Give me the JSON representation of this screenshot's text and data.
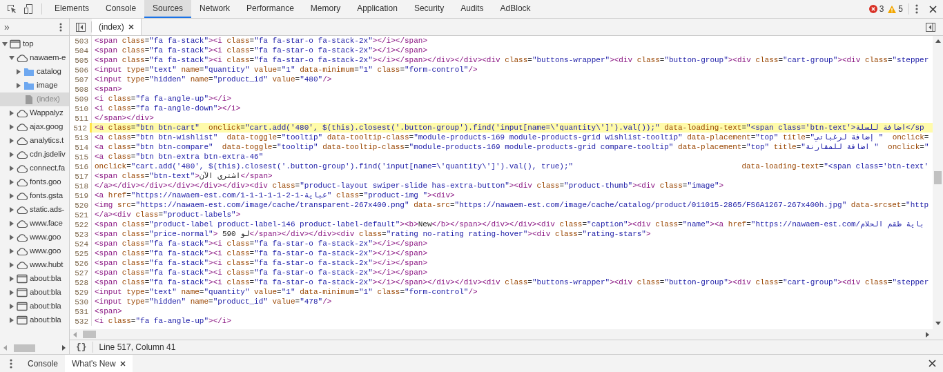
{
  "toolbar": {
    "tabs": [
      {
        "label": "Elements",
        "selected": false
      },
      {
        "label": "Console",
        "selected": false
      },
      {
        "label": "Sources",
        "selected": true
      },
      {
        "label": "Network",
        "selected": false
      },
      {
        "label": "Performance",
        "selected": false
      },
      {
        "label": "Memory",
        "selected": false
      },
      {
        "label": "Application",
        "selected": false
      },
      {
        "label": "Security",
        "selected": false
      },
      {
        "label": "Audits",
        "selected": false
      },
      {
        "label": "AdBlock",
        "selected": false
      }
    ],
    "errors": "3",
    "warnings": "5"
  },
  "editor_tabs": [
    {
      "label": "(index)",
      "selected": true
    }
  ],
  "navigator": {
    "more_tabs": "»",
    "tree": [
      {
        "label": "top",
        "kind": "frame",
        "expanded": true,
        "selected": false,
        "children": [
          {
            "label": "nawaem-e",
            "kind": "cloud",
            "expanded": true,
            "selected": false,
            "children": [
              {
                "label": "catalog",
                "kind": "folder",
                "expanded": false,
                "selected": false
              },
              {
                "label": "image",
                "kind": "folder",
                "expanded": false,
                "selected": false
              },
              {
                "label": "(index)",
                "kind": "file",
                "selected": true
              }
            ]
          },
          {
            "label": "Wappalyz",
            "kind": "cloud",
            "expanded": false,
            "selected": false
          },
          {
            "label": "ajax.goog",
            "kind": "cloud",
            "expanded": false,
            "selected": false
          },
          {
            "label": "analytics.t",
            "kind": "cloud",
            "expanded": false,
            "selected": false
          },
          {
            "label": "cdn.jsdeliv",
            "kind": "cloud",
            "expanded": false,
            "selected": false
          },
          {
            "label": "connect.fa",
            "kind": "cloud",
            "expanded": false,
            "selected": false
          },
          {
            "label": "fonts.goo",
            "kind": "cloud",
            "expanded": false,
            "selected": false
          },
          {
            "label": "fonts.gsta",
            "kind": "cloud",
            "expanded": false,
            "selected": false
          },
          {
            "label": "static.ads-",
            "kind": "cloud",
            "expanded": false,
            "selected": false
          },
          {
            "label": "www.face",
            "kind": "cloud",
            "expanded": false,
            "selected": false
          },
          {
            "label": "www.goo",
            "kind": "cloud",
            "expanded": false,
            "selected": false
          },
          {
            "label": "www.goo",
            "kind": "cloud",
            "expanded": false,
            "selected": false
          },
          {
            "label": "www.hubt",
            "kind": "cloud",
            "expanded": false,
            "selected": false
          },
          {
            "label": "about:bla",
            "kind": "frame",
            "expanded": false,
            "selected": false
          },
          {
            "label": "about:bla",
            "kind": "frame",
            "expanded": false,
            "selected": false
          },
          {
            "label": "about:bla",
            "kind": "frame",
            "expanded": false,
            "selected": false
          },
          {
            "label": "about:bla",
            "kind": "frame",
            "expanded": false,
            "selected": false
          }
        ]
      }
    ]
  },
  "code_lines": [
    {
      "number": "503",
      "text": "<span class=\"fa fa-stack\"><i class=\"fa fa-star-o fa-stack-2x\"></i></span>",
      "highlighted": false
    },
    {
      "number": "504",
      "text": "<span class=\"fa fa-stack\"><i class=\"fa fa-star-o fa-stack-2x\"></i></span>",
      "highlighted": false
    },
    {
      "number": "505",
      "text": "<span class=\"fa fa-stack\"><i class=\"fa fa-star-o fa-stack-2x\"></i></span></div></div><div class=\"buttons-wrapper\"><div class=\"button-group\"><div class=\"cart-group\"><div class=\"stepper",
      "highlighted": false
    },
    {
      "number": "506",
      "text": "<input type=\"text\" name=\"quantity\" value=\"1\" data-minimum=\"1\" class=\"form-control\"/>",
      "highlighted": false
    },
    {
      "number": "507",
      "text": "<input type=\"hidden\" name=\"product_id\" value=\"480\"/>",
      "highlighted": false
    },
    {
      "number": "508",
      "text": "<span>",
      "highlighted": false
    },
    {
      "number": "509",
      "text": "<i class=\"fa fa-angle-up\"></i>",
      "highlighted": false
    },
    {
      "number": "510",
      "text": "<i class=\"fa fa-angle-down\"></i>",
      "highlighted": false
    },
    {
      "number": "511",
      "text": "</span></div>",
      "highlighted": false
    },
    {
      "number": "512",
      "text": "<a class=\"btn btn-cart\"  onclick=\"cart.add('480', $(this).closest('.button-group').find('input[name=\\'quantity\\']').val());\" data-loading-text=\"<span class='btn-text'>اضافة للسلة</sp",
      "highlighted": true
    },
    {
      "number": "513",
      "text": "<a class=\"btn btn-wishlist\"  data-toggle=\"tooltip\" data-tooltip-class=\"module-products-169 module-products-grid wishlist-tooltip\" data-placement=\"top\" title=\"إضافة لرغباتي \"  onclick=",
      "highlighted": false
    },
    {
      "number": "514",
      "text": "<a class=\"btn btn-compare\"  data-toggle=\"tooltip\" data-tooltip-class=\"module-products-169 module-products-grid compare-tooltip\" data-placement=\"top\" title=\"اضافة للمقارنة \"  onclick=\"",
      "highlighted": false
    },
    {
      "number": "515",
      "text": "<a class=\"btn btn-extra btn-extra-46\"",
      "highlighted": false
    },
    {
      "number": "516",
      "text": "onclick=\"cart.add('480', $(this).closest('.button-group').find('input[name=\\'quantity\\']').val(), true);\"                                     data-loading-text=\"<span class='btn-text'",
      "highlighted": false
    },
    {
      "number": "517",
      "text": "<span class=\"btn-text\">اشتري الآن</span>",
      "highlighted": false
    },
    {
      "number": "518",
      "text": "</a></div></div></div></div></div><div class=\"product-layout swiper-slide has-extra-button\"><div class=\"product-thumb\"><div class=\"image\">",
      "highlighted": false
    },
    {
      "number": "519",
      "text": "<a href=\"https://nawaem-est.com/1-1-1-1-1-2-1-عباية\" class=\"product-img \"><div>",
      "highlighted": false
    },
    {
      "number": "520",
      "text": "<img src=\"https://nawaem-est.com/image/cache/transparent-267x400.png\" data-src=\"https://nawaem-est.com/image/cache/catalog/product/011015-2865/FS6A1267-267x400h.jpg\" data-srcset=\"http",
      "highlighted": false
    },
    {
      "number": "521",
      "text": "</a><div class=\"product-labels\">",
      "highlighted": false
    },
    {
      "number": "522",
      "text": "<span class=\"product-label product-label-146 product-label-default\"><b>New</b></span></div></div><div class=\"caption\"><div class=\"name\"><a href=\"https://nawaem-est.com/باية طقم الحلام",
      "highlighted": false
    },
    {
      "number": "523",
      "text": "<span class=\"price-normal\"> 590 لو</span></div></div><div class=\"rating no-rating rating-hover\"><div class=\"rating-stars\">",
      "highlighted": false
    },
    {
      "number": "524",
      "text": "<span class=\"fa fa-stack\"><i class=\"fa fa-star-o fa-stack-2x\"></i></span>",
      "highlighted": false
    },
    {
      "number": "525",
      "text": "<span class=\"fa fa-stack\"><i class=\"fa fa-star-o fa-stack-2x\"></i></span>",
      "highlighted": false
    },
    {
      "number": "526",
      "text": "<span class=\"fa fa-stack\"><i class=\"fa fa-star-o fa-stack-2x\"></i></span>",
      "highlighted": false
    },
    {
      "number": "527",
      "text": "<span class=\"fa fa-stack\"><i class=\"fa fa-star-o fa-stack-2x\"></i></span>",
      "highlighted": false
    },
    {
      "number": "528",
      "text": "<span class=\"fa fa-stack\"><i class=\"fa fa-star-o fa-stack-2x\"></i></span></div></div><div class=\"buttons-wrapper\"><div class=\"button-group\"><div class=\"cart-group\"><div class=\"stepper",
      "highlighted": false
    },
    {
      "number": "529",
      "text": "<input type=\"text\" name=\"quantity\" value=\"1\" data-minimum=\"1\" class=\"form-control\"/>",
      "highlighted": false
    },
    {
      "number": "530",
      "text": "<input type=\"hidden\" name=\"product_id\" value=\"478\"/>",
      "highlighted": false
    },
    {
      "number": "531",
      "text": "<span>",
      "highlighted": false
    },
    {
      "number": "532",
      "text": "<i class=\"fa fa-angle-up\"></i>",
      "highlighted": false
    }
  ],
  "status_bar": {
    "format_button": "{}",
    "position": "Line 517, Column 41"
  },
  "drawer_tabs": [
    {
      "label": "Console",
      "selected": false,
      "closable": false
    },
    {
      "label": "What's New",
      "selected": true,
      "closable": true
    }
  ]
}
